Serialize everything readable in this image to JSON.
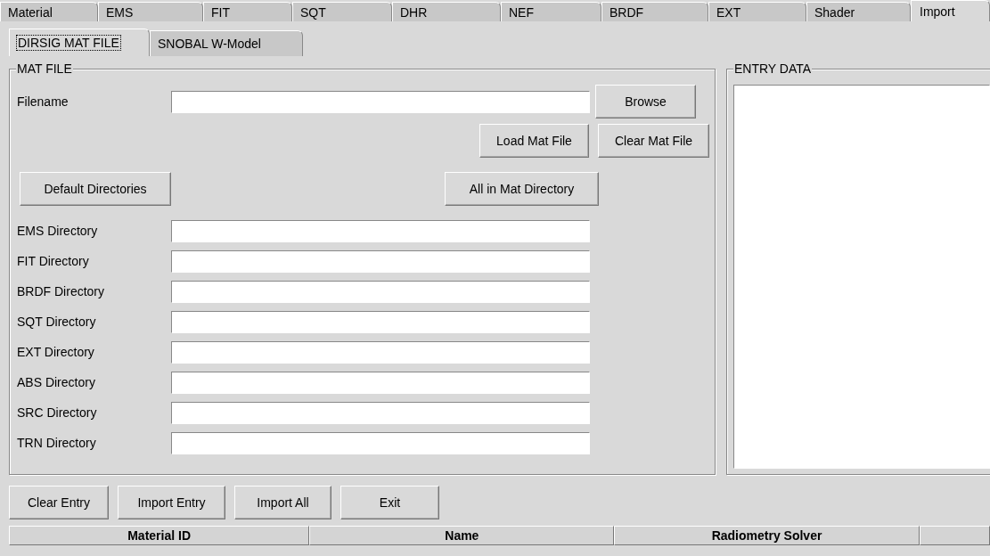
{
  "tabs": [
    {
      "label": "Material",
      "selected": false
    },
    {
      "label": "EMS",
      "selected": false
    },
    {
      "label": "FIT",
      "selected": false
    },
    {
      "label": "SQT",
      "selected": false
    },
    {
      "label": "DHR",
      "selected": false
    },
    {
      "label": "NEF",
      "selected": false
    },
    {
      "label": "BRDF",
      "selected": false
    },
    {
      "label": "EXT",
      "selected": false
    },
    {
      "label": "Shader",
      "selected": false
    },
    {
      "label": "Import",
      "selected": true
    }
  ],
  "subtabs": [
    {
      "label": "DIRSIG MAT FILE",
      "selected": true
    },
    {
      "label": "SNOBAL W-Model",
      "selected": false
    }
  ],
  "mat_file": {
    "title": "MAT FILE",
    "filename_label": "Filename",
    "browse": "Browse",
    "load": "Load Mat File",
    "clear": "Clear Mat File",
    "default_dirs": "Default Directories",
    "all_in_dir": "All in Mat Directory",
    "directories": [
      {
        "label": "EMS Directory"
      },
      {
        "label": "FIT Directory"
      },
      {
        "label": "BRDF Directory"
      },
      {
        "label": "SQT Directory"
      },
      {
        "label": "EXT Directory"
      },
      {
        "label": "ABS Directory"
      },
      {
        "label": "SRC Directory"
      },
      {
        "label": "TRN Directory"
      }
    ]
  },
  "entry_data": {
    "title": "ENTRY DATA"
  },
  "buttons": [
    "Clear Entry",
    "Import Entry",
    "Import All",
    "Exit"
  ],
  "table": {
    "columns": [
      "Material ID",
      "Name",
      "Radiometry Solver"
    ]
  }
}
